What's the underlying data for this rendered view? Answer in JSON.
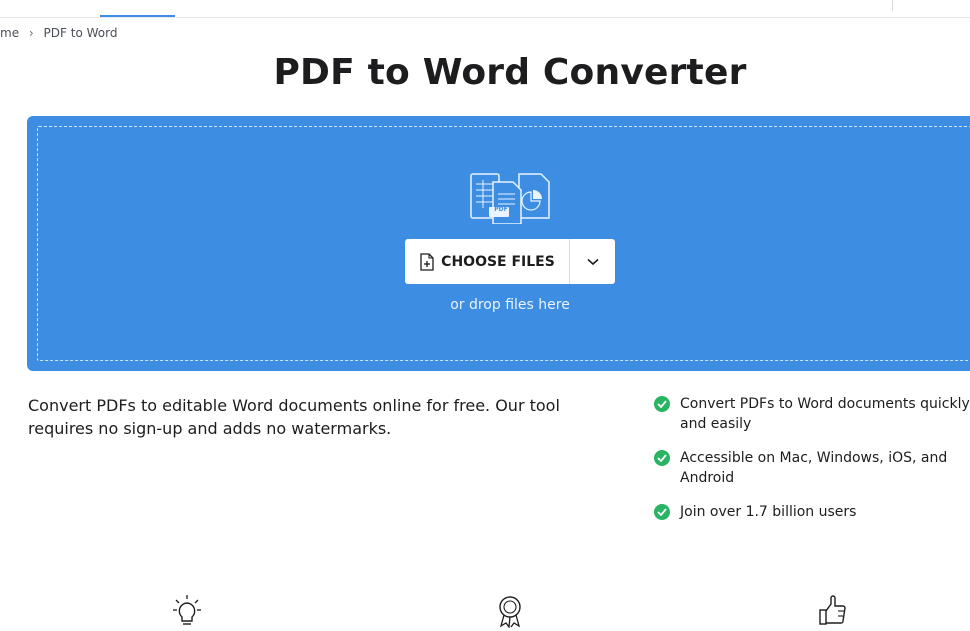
{
  "breadcrumb": {
    "home": "me",
    "separator": "›",
    "current": "PDF to Word"
  },
  "page_title": "PDF to Word Converter",
  "uploader": {
    "choose_label": "CHOOSE FILES",
    "drop_hint": "or drop files here",
    "illustration_badge": "PDF"
  },
  "description": "Convert PDFs to editable Word documents online for free. Our tool requires no sign-up and adds no watermarks.",
  "features": [
    "Convert PDFs to Word documents quickly and easily",
    "Accessible on Mac, Windows, iOS, and Android",
    "Join over 1.7 billion users"
  ],
  "bottom_icons": [
    "lightbulb-icon",
    "award-ribbon-icon",
    "thumbs-up-icon"
  ],
  "colors": {
    "accent": "#3d8ee2",
    "check": "#28b463",
    "text": "#1d1d1f"
  }
}
